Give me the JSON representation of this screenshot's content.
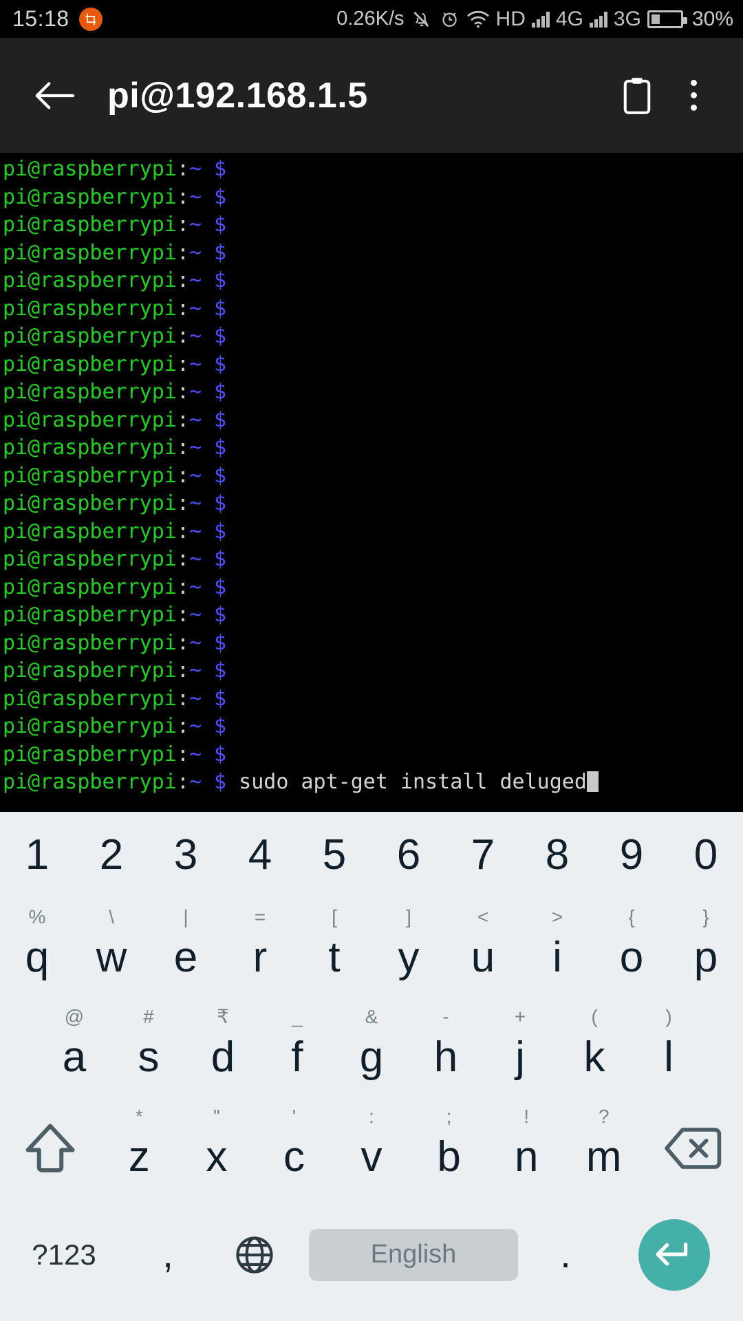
{
  "status_bar": {
    "time": "15:18",
    "app_badge_icon": "screenshot-crop-icon",
    "network_speed": "0.26K/s",
    "icons": [
      "mute-bell-icon",
      "alarm-clock-icon",
      "wifi-icon"
    ],
    "hd_label": "HD",
    "sim1_label": "4G",
    "sim2_label": "3G",
    "battery_percent": "30%",
    "battery_level": 30
  },
  "app_bar": {
    "back_icon": "back-arrow-icon",
    "title": "pi@192.168.1.5",
    "clipboard_icon": "clipboard-icon",
    "overflow_icon": "overflow-menu-icon"
  },
  "terminal": {
    "prompt_user": "pi@raspberrypi",
    "prompt_colon": ":",
    "prompt_path": "~",
    "prompt_dollar": "$",
    "blank_prompt_count": 22,
    "command": "sudo apt-get install deluged",
    "colors": {
      "background": "#000000",
      "user": "#20d020",
      "path": "#4d4dff",
      "dollar": "#4d4dff",
      "command": "#d4d4d4",
      "cursor": "#c9c9c9"
    }
  },
  "keyboard": {
    "theme": {
      "background": "#eceff1",
      "key_text": "#101f29",
      "sub_text": "#78868e",
      "spacebar_bg": "#c9ced1",
      "enter_bg": "#45b0a8"
    },
    "row_numbers": [
      {
        "main": "1"
      },
      {
        "main": "2"
      },
      {
        "main": "3"
      },
      {
        "main": "4"
      },
      {
        "main": "5"
      },
      {
        "main": "6"
      },
      {
        "main": "7"
      },
      {
        "main": "8"
      },
      {
        "main": "9"
      },
      {
        "main": "0"
      }
    ],
    "row_q": [
      {
        "main": "q",
        "sub": "%"
      },
      {
        "main": "w",
        "sub": "\\"
      },
      {
        "main": "e",
        "sub": "|"
      },
      {
        "main": "r",
        "sub": "="
      },
      {
        "main": "t",
        "sub": "["
      },
      {
        "main": "y",
        "sub": "]"
      },
      {
        "main": "u",
        "sub": "<"
      },
      {
        "main": "i",
        "sub": ">"
      },
      {
        "main": "o",
        "sub": "{"
      },
      {
        "main": "p",
        "sub": "}"
      }
    ],
    "row_a": [
      {
        "main": "a",
        "sub": "@"
      },
      {
        "main": "s",
        "sub": "#"
      },
      {
        "main": "d",
        "sub": "₹"
      },
      {
        "main": "f",
        "sub": "_"
      },
      {
        "main": "g",
        "sub": "&"
      },
      {
        "main": "h",
        "sub": "-"
      },
      {
        "main": "j",
        "sub": "+"
      },
      {
        "main": "k",
        "sub": "("
      },
      {
        "main": "l",
        "sub": ")"
      }
    ],
    "row_z": [
      {
        "main": "z",
        "sub": "*"
      },
      {
        "main": "x",
        "sub": "\""
      },
      {
        "main": "c",
        "sub": "'"
      },
      {
        "main": "v",
        "sub": ":"
      },
      {
        "main": "b",
        "sub": ";"
      },
      {
        "main": "n",
        "sub": "!"
      },
      {
        "main": "m",
        "sub": "?"
      }
    ],
    "shift_icon": "shift-arrow-icon",
    "backspace_icon": "backspace-icon",
    "symbols_label": "?123",
    "comma_label": ",",
    "globe_icon": "language-globe-icon",
    "spacebar_label": "English",
    "period_label": ".",
    "enter_icon": "enter-return-icon"
  }
}
